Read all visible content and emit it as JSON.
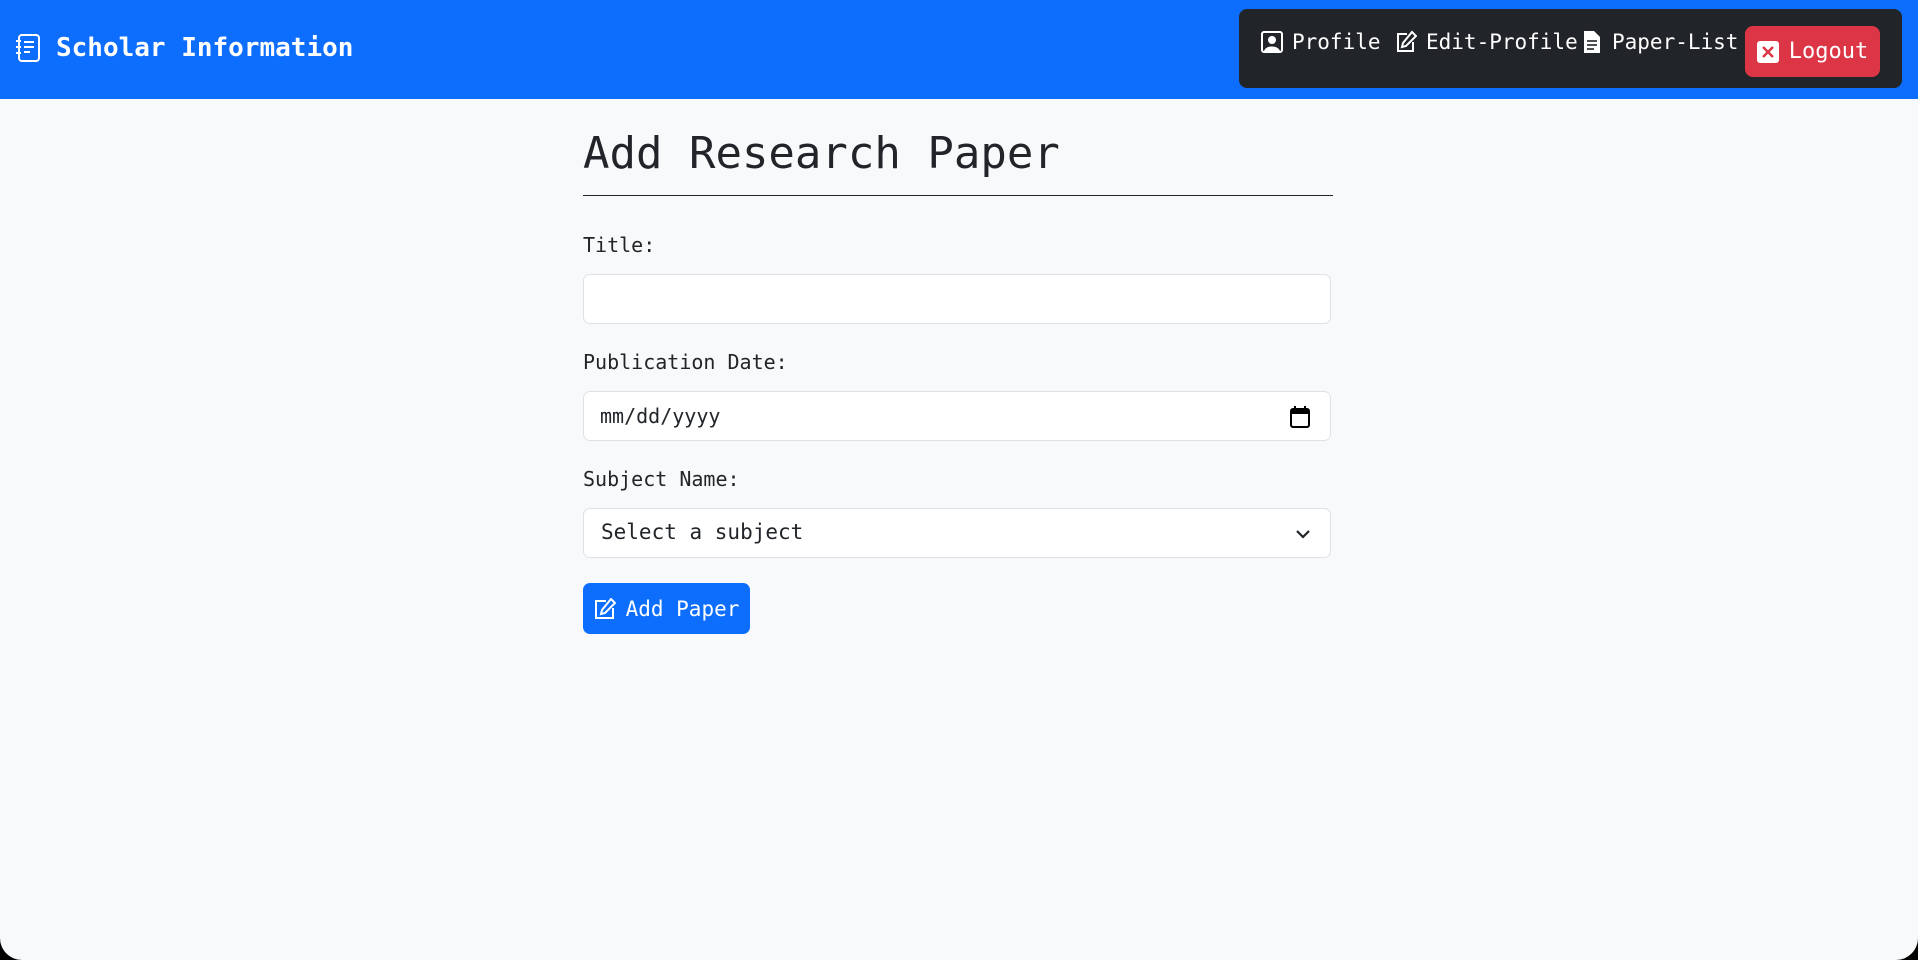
{
  "header": {
    "brand": "Scholar Information",
    "nav": {
      "profile": "Profile",
      "edit_profile": "Edit-Profile",
      "paper_list": "Paper-List",
      "logout": "Logout"
    }
  },
  "form": {
    "heading": "Add Research Paper",
    "title_label": "Title:",
    "title_value": "",
    "date_label": "Publication Date:",
    "date_placeholder": "mm/dd/yyyy",
    "subject_label": "Subject Name:",
    "subject_selected": "Select a subject",
    "submit_label": "Add Paper"
  },
  "colors": {
    "primary": "#0d6efd",
    "danger": "#dc3545",
    "dark": "#212529",
    "background": "#f8f9fa"
  },
  "icons": {
    "brand": "journal-text-icon",
    "profile": "person-square-icon",
    "edit": "pencil-square-icon",
    "paper_list": "file-text-icon",
    "logout": "x-square-icon",
    "calendar": "calendar-icon",
    "chevron": "chevron-down-icon"
  }
}
